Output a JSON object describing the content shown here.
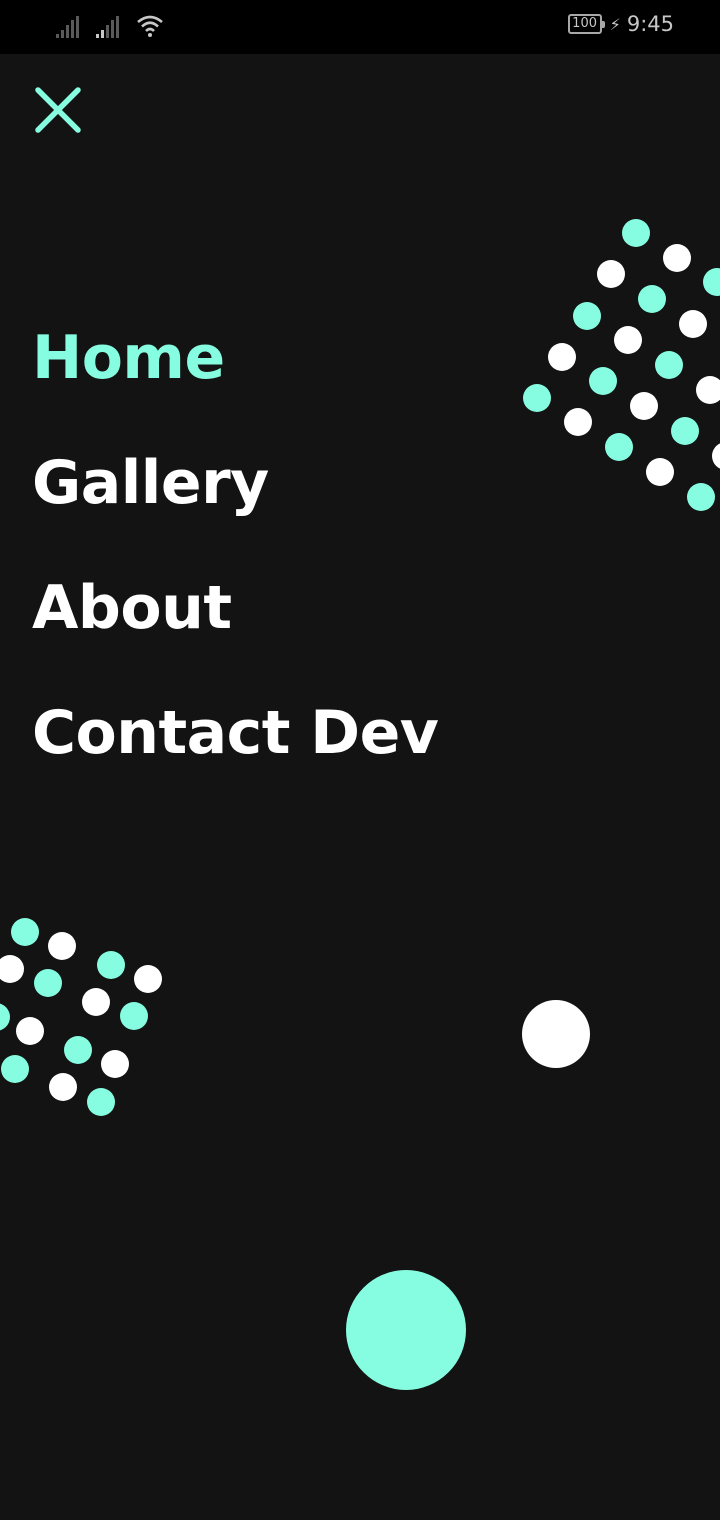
{
  "status_bar": {
    "battery": "100",
    "time": "9:45",
    "icons": [
      "signal-icon",
      "signal-icon",
      "wifi-icon",
      "battery-icon",
      "charging-icon"
    ]
  },
  "close_icon": "close-icon",
  "nav": {
    "items": [
      {
        "label": "Home",
        "active": true
      },
      {
        "label": "Gallery",
        "active": false
      },
      {
        "label": "About",
        "active": false
      },
      {
        "label": "Contact Dev",
        "active": false
      }
    ]
  },
  "colors": {
    "accent": "#86fde0",
    "background": "#131313",
    "status_bar": "#000000",
    "text": "#ffffff"
  }
}
